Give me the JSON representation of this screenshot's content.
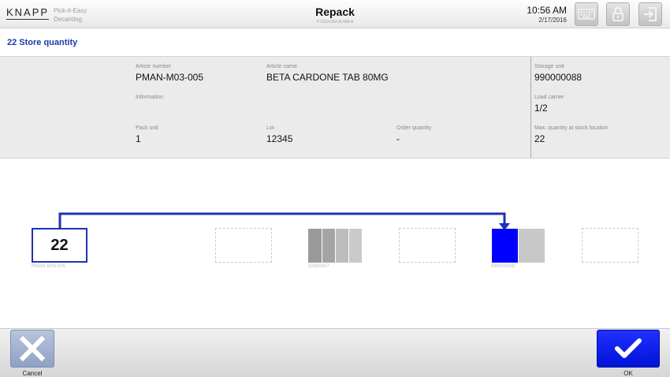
{
  "header": {
    "logo": "KNAPP",
    "logo_sub1": "Pick-it-Easy",
    "logo_sub2": "Decanting",
    "title": "Repack",
    "subcode": "F-CGU-DECA-008-A",
    "time": "10:56 AM",
    "date": "2/17/2016",
    "icons": [
      "keyboard-icon",
      "lock-icon",
      "logout-icon"
    ]
  },
  "step_title": "22 Store quantity",
  "info": {
    "article_number": {
      "label": "Article number",
      "value": "PMAN-M03-005"
    },
    "article_name": {
      "label": "Article name",
      "value": "BETA CARDONE TAB 80MG"
    },
    "information": {
      "label": "Information",
      "value": ""
    },
    "pack_unit": {
      "label": "Pack unit",
      "value": "1"
    },
    "lot": {
      "label": "Lot",
      "value": "12345"
    },
    "order_quantity": {
      "label": "Order quantity",
      "value": "-"
    },
    "storage_unit": {
      "label": "Storage unit",
      "value": "990000088"
    },
    "load_carrier": {
      "label": "Load carrier",
      "value": "1/2"
    },
    "max_quantity": {
      "label": "Max. quantity at stock location",
      "value": "22"
    }
  },
  "viz": {
    "quantity": "22",
    "quantity_caption": "PMAN-M03-005",
    "source_caption": "10000007",
    "target_caption": "990000088",
    "colors": {
      "accent": "#1d32b5",
      "target_fill": "#0000ff",
      "comp_dark": "#9a9a9a",
      "comp_light": "#c8c8c8"
    }
  },
  "footer": {
    "cancel_label": "Cancel",
    "ok_label": "OK"
  }
}
